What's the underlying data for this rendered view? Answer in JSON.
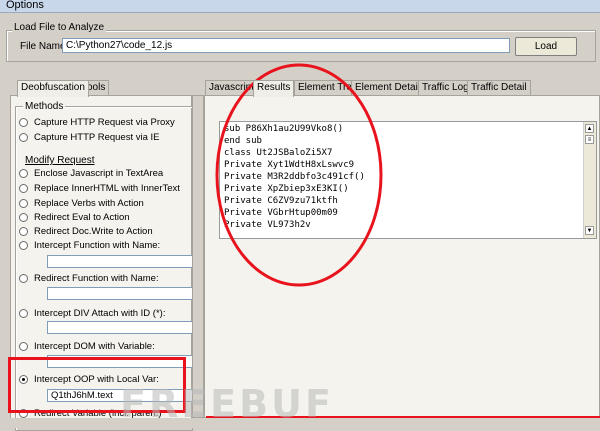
{
  "window": {
    "title": "Options"
  },
  "load_file": {
    "group_label": "Load File to Analyze",
    "file_name_label": "File Name:",
    "file_name_value": "C:\\Python27\\code_12.js",
    "load_button": "Load"
  },
  "left_tabs": [
    "Deobfuscation",
    "Tools"
  ],
  "methods": {
    "group_label": "Methods",
    "options": [
      {
        "label": "Capture HTTP Request via Proxy",
        "selected": false
      },
      {
        "label": "Capture HTTP Request via IE",
        "selected": false
      }
    ],
    "modify_request_label": "Modify Request",
    "modify_options": [
      {
        "label": "Enclose Javascript in TextArea",
        "selected": false
      },
      {
        "label": "Replace InnerHTML with InnerText",
        "selected": false
      },
      {
        "label": "Replace Verbs with Action",
        "selected": false
      },
      {
        "label": "Redirect Eval to Action",
        "selected": false
      },
      {
        "label": "Redirect Doc.Write to Action",
        "selected": false
      },
      {
        "label": "Intercept Function with Name:",
        "selected": false,
        "input": ""
      },
      {
        "label": "Redirect Function with Name:",
        "selected": false,
        "input": ""
      },
      {
        "label": "Intercept DIV Attach with ID (*):",
        "selected": false,
        "input": ""
      },
      {
        "label": "Intercept DOM with Variable:",
        "selected": false,
        "input": ""
      },
      {
        "label": "Intercept OOP with Local Var:",
        "selected": true,
        "input": "Q1thJ6hM.text"
      },
      {
        "label": "Redirect Variable (incl. paren.)",
        "selected": false
      }
    ]
  },
  "right_tabs": [
    "Javascript",
    "Results",
    "Element Tree",
    "Element Detail",
    "Traffic Log",
    "Traffic Detail"
  ],
  "active_right_tab": "Results",
  "results_lines": [
    "sub P86Xh1au2U99Vko8()",
    "end sub",
    "class Ut2JSBaloZi5X7",
    "Private Xyt1WdtH8xLswvc9",
    "Private M3R2ddbfo3c491cf()",
    "Private XpZbiep3xE3KI()",
    "Private C6ZV9zu71ktfh",
    "Private VGbrHtup00m09",
    "Private VL973h2v"
  ],
  "watermark": "FREEBUF"
}
